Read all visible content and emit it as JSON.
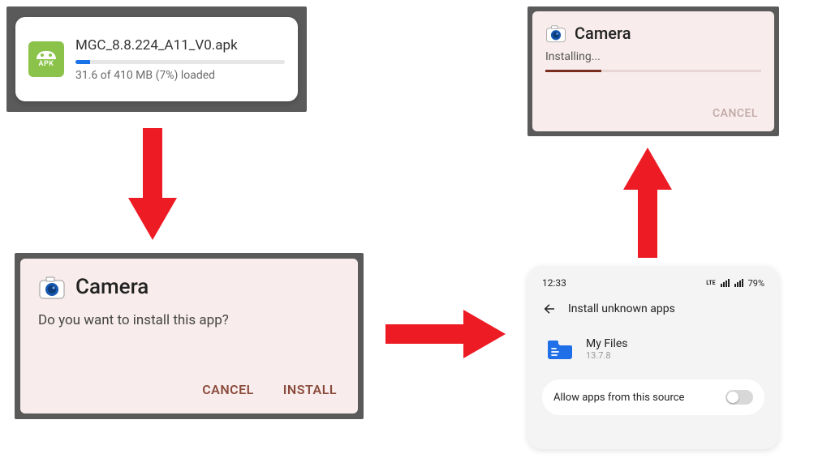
{
  "panel1": {
    "apk_label": "APK",
    "filename": "MGC_8.8.224_A11_V0.apk",
    "progress_text": "31.6 of 410 MB (7%) loaded",
    "progress_pct": 7
  },
  "panel2": {
    "title": "Camera",
    "message": "Do you want to install this app?",
    "cancel": "CANCEL",
    "install": "INSTALL"
  },
  "panel3": {
    "title": "Camera",
    "status": "Installing...",
    "cancel": "CANCEL",
    "progress_pct": 26
  },
  "panel4": {
    "time": "12:33",
    "battery": "79%",
    "header": "Install unknown apps",
    "app_name": "My Files",
    "app_version": "13.7.8",
    "allow_label": "Allow apps from this source"
  }
}
